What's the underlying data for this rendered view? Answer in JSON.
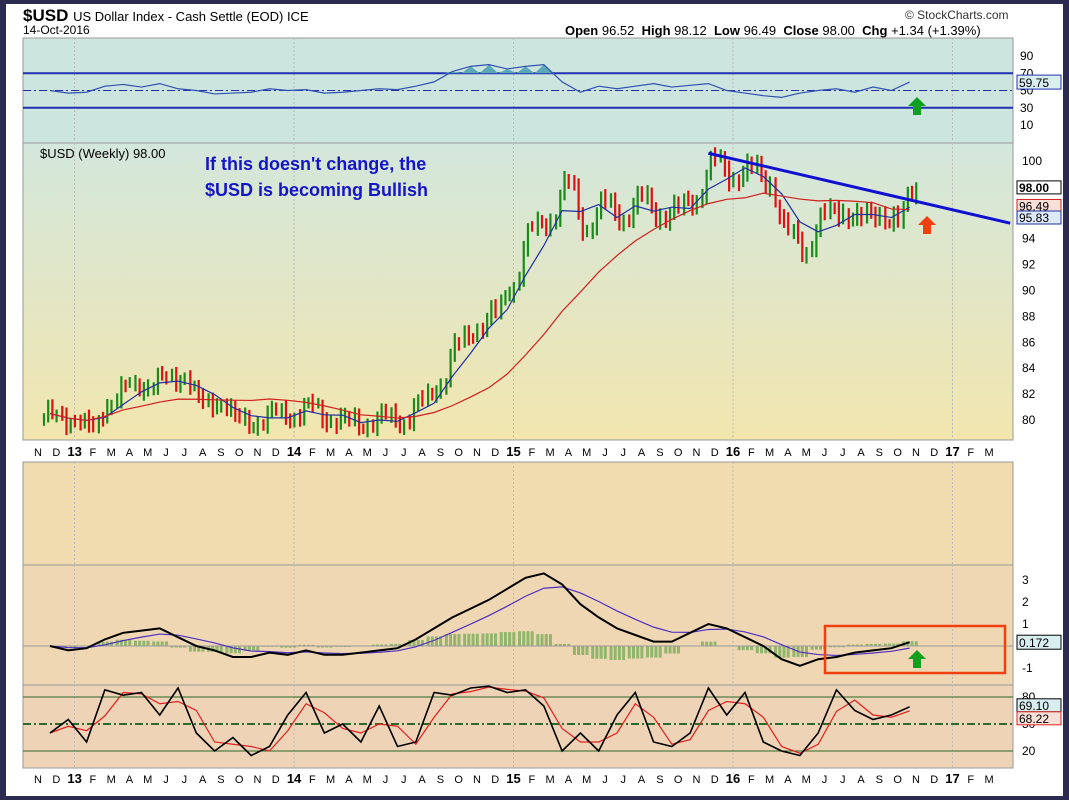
{
  "header": {
    "symbol": "$USD",
    "name": "US Dollar Index - Cash Settle (EOD) ICE",
    "date": "14-Oct-2016",
    "copyright": "© StockCharts.com",
    "open_label": "Open",
    "open": "96.52",
    "high_label": "High",
    "high": "98.12",
    "low_label": "Low",
    "low": "96.49",
    "close_label": "Close",
    "close": "98.00",
    "chg_label": "Chg",
    "chg": "+1.34 (+1.39%)"
  },
  "price_legend": "$USD (Weekly) 98.00",
  "annotation": {
    "line1": "If this doesn't change, the",
    "line2": "$USD is becoming Bullish"
  },
  "colors": {
    "up": "#1a8a1a",
    "down": "#e01010",
    "ma_short": "#2030a0",
    "ma_long": "#d02020",
    "trend": "#1010d0",
    "rsi": "#3050b0",
    "box": "#f04010",
    "arrow_green": "#10a020",
    "arrow_red": "#f04010"
  },
  "chart_data": [
    {
      "type": "line",
      "title": "RSI",
      "ylim": [
        0,
        100
      ],
      "ticks": [
        "90",
        "70",
        "50",
        "30",
        "10"
      ],
      "levels": [
        70,
        50,
        30
      ],
      "values": [
        50,
        47,
        48,
        55,
        57,
        54,
        58,
        52,
        50,
        46,
        47,
        48,
        52,
        50,
        51,
        47,
        48,
        50,
        52,
        51,
        55,
        60,
        72,
        78,
        80,
        75,
        78,
        80,
        60,
        48,
        55,
        52,
        55,
        58,
        54,
        56,
        58,
        50,
        47,
        44,
        42,
        47,
        50,
        52,
        48,
        54,
        50,
        59.75
      ],
      "last_label": "59.75"
    },
    {
      "type": "ohlc",
      "title": "$USD (Weekly)",
      "x_months": "Nov 2012 - Oct 2016",
      "closes": [
        80.5,
        79.8,
        79.6,
        81.2,
        82.8,
        82.5,
        83.3,
        83.2,
        81.5,
        81.2,
        80.2,
        79.6,
        80.7,
        80.2,
        81.2,
        79.8,
        80.1,
        79.5,
        80.4,
        79.8,
        81.5,
        82.6,
        86.0,
        86.9,
        88.4,
        90.3,
        94.8,
        95.3,
        98.4,
        94.6,
        96.9,
        95.4,
        97.3,
        95.7,
        96.3,
        97.0,
        100.2,
        98.6,
        99.6,
        98.2,
        94.6,
        93.1,
        95.9,
        96.1,
        95.6,
        95.9,
        95.4,
        98.0
      ],
      "ylim": [
        79,
        101.5
      ],
      "ticks": [
        "100",
        "98",
        "96",
        "94",
        "92",
        "90",
        "88",
        "86",
        "84",
        "82",
        "80"
      ],
      "value_labels": [
        "98.00",
        "96.49",
        "95.83"
      ],
      "trendline": {
        "from": [
          36,
          100.6
        ],
        "to": [
          52.5,
          95.2
        ]
      }
    },
    {
      "type": "line",
      "title": "MACD",
      "ticks": [
        "3",
        "2",
        "1",
        "-1"
      ],
      "macd": [
        0,
        -0.2,
        -0.1,
        0.3,
        0.6,
        0.7,
        0.8,
        0.4,
        0,
        -0.2,
        -0.5,
        -0.5,
        -0.3,
        -0.4,
        -0.2,
        -0.4,
        -0.4,
        -0.3,
        -0.2,
        -0.1,
        0.3,
        0.8,
        1.3,
        1.7,
        2.1,
        2.6,
        3.1,
        3.3,
        2.8,
        1.9,
        1.3,
        0.8,
        0.5,
        0.2,
        0.2,
        0.6,
        1.0,
        0.8,
        0.4,
        0.0,
        -0.6,
        -0.9,
        -0.6,
        -0.5,
        -0.3,
        -0.2,
        -0.1,
        0.172
      ],
      "last_label": "0.172"
    },
    {
      "type": "line",
      "title": "Stochastic",
      "ticks": [
        "80",
        "50",
        "20"
      ],
      "levels": [
        80,
        50,
        20
      ],
      "k": [
        40,
        55,
        30,
        88,
        82,
        85,
        60,
        90,
        40,
        20,
        35,
        15,
        25,
        60,
        85,
        40,
        50,
        30,
        70,
        25,
        30,
        85,
        82,
        90,
        92,
        85,
        88,
        70,
        20,
        40,
        20,
        60,
        85,
        30,
        25,
        40,
        90,
        60,
        85,
        30,
        20,
        15,
        40,
        88,
        65,
        55,
        60,
        69.1
      ],
      "k_label": "69.10",
      "d_label": "68.22"
    }
  ],
  "x_axis": [
    "N",
    "D",
    "13",
    "F",
    "M",
    "A",
    "M",
    "J",
    "J",
    "A",
    "S",
    "O",
    "N",
    "D",
    "14",
    "F",
    "M",
    "A",
    "M",
    "J",
    "J",
    "A",
    "S",
    "O",
    "N",
    "D",
    "15",
    "F",
    "M",
    "A",
    "M",
    "J",
    "J",
    "A",
    "S",
    "O",
    "N",
    "D",
    "16",
    "F",
    "M",
    "A",
    "M",
    "J",
    "J",
    "A",
    "S",
    "O",
    "N",
    "D",
    "17",
    "F",
    "M"
  ]
}
